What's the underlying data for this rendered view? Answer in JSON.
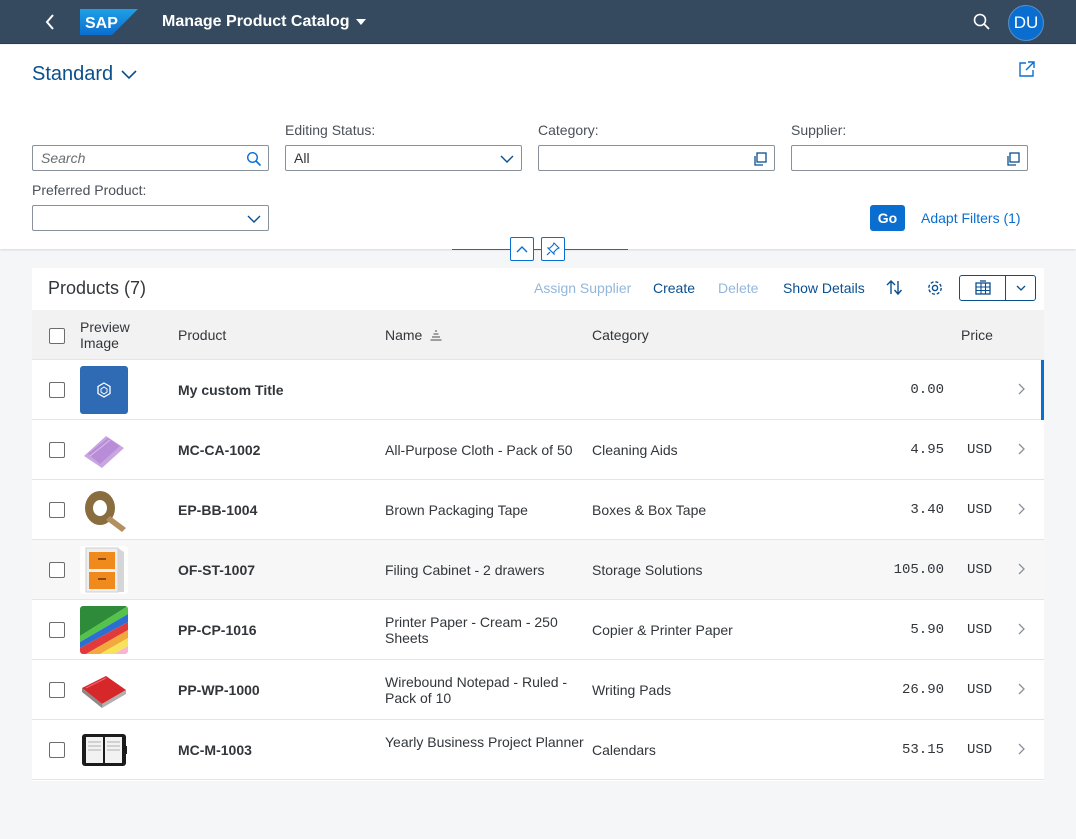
{
  "shell": {
    "logo_text": "SAP",
    "app_title": "Manage Product Catalog",
    "avatar_initials": "DU",
    "colors": {
      "shell_bg": "#354a5f",
      "accent": "#0a6ed1"
    }
  },
  "variant": {
    "name": "Standard"
  },
  "filters": {
    "search": {
      "placeholder": "Search",
      "value": ""
    },
    "editing_status": {
      "label": "Editing Status:",
      "value": "All"
    },
    "category": {
      "label": "Category:",
      "value": ""
    },
    "supplier": {
      "label": "Supplier:",
      "value": ""
    },
    "preferred_product": {
      "label": "Preferred Product:",
      "value": ""
    },
    "go_label": "Go",
    "adapt_label": "Adapt Filters (1)"
  },
  "table": {
    "title": "Products (7)",
    "toolbar": {
      "assign_supplier": "Assign Supplier",
      "create": "Create",
      "delete": "Delete",
      "show_details": "Show Details"
    },
    "columns": {
      "preview_line1": "Preview",
      "preview_line2": "Image",
      "product": "Product",
      "name": "Name",
      "category": "Category",
      "price": "Price"
    },
    "rows": [
      {
        "product": "My custom Title",
        "name": "",
        "category": "",
        "price": "0.00",
        "currency": "",
        "image": "placeholder-product-icon"
      },
      {
        "product": "MC-CA-1002",
        "name": "All-Purpose Cloth - Pack of 50",
        "category": "Cleaning Aids",
        "price": "4.95",
        "currency": "USD",
        "image": "cloth-image"
      },
      {
        "product": "EP-BB-1004",
        "name": "Brown Packaging Tape",
        "category": "Boxes & Box Tape",
        "price": "3.40",
        "currency": "USD",
        "image": "tape-image"
      },
      {
        "product": "OF-ST-1007",
        "name": "Filing Cabinet - 2 drawers",
        "category": "Storage Solutions",
        "price": "105.00",
        "currency": "USD",
        "image": "cabinet-image"
      },
      {
        "product": "PP-CP-1016",
        "name": "Printer Paper - Cream - 250 Sheets",
        "category": "Copier & Printer Paper",
        "price": "5.90",
        "currency": "USD",
        "image": "paper-image"
      },
      {
        "product": "PP-WP-1000",
        "name": "Wirebound Notepad - Ruled - Pack of 10",
        "category": "Writing Pads",
        "price": "26.90",
        "currency": "USD",
        "image": "notepad-image"
      },
      {
        "product": "MC-M-1003",
        "name": "Yearly Business Project Planner",
        "category": "Calendars",
        "price": "53.15",
        "currency": "USD",
        "image": "planner-image"
      }
    ]
  }
}
